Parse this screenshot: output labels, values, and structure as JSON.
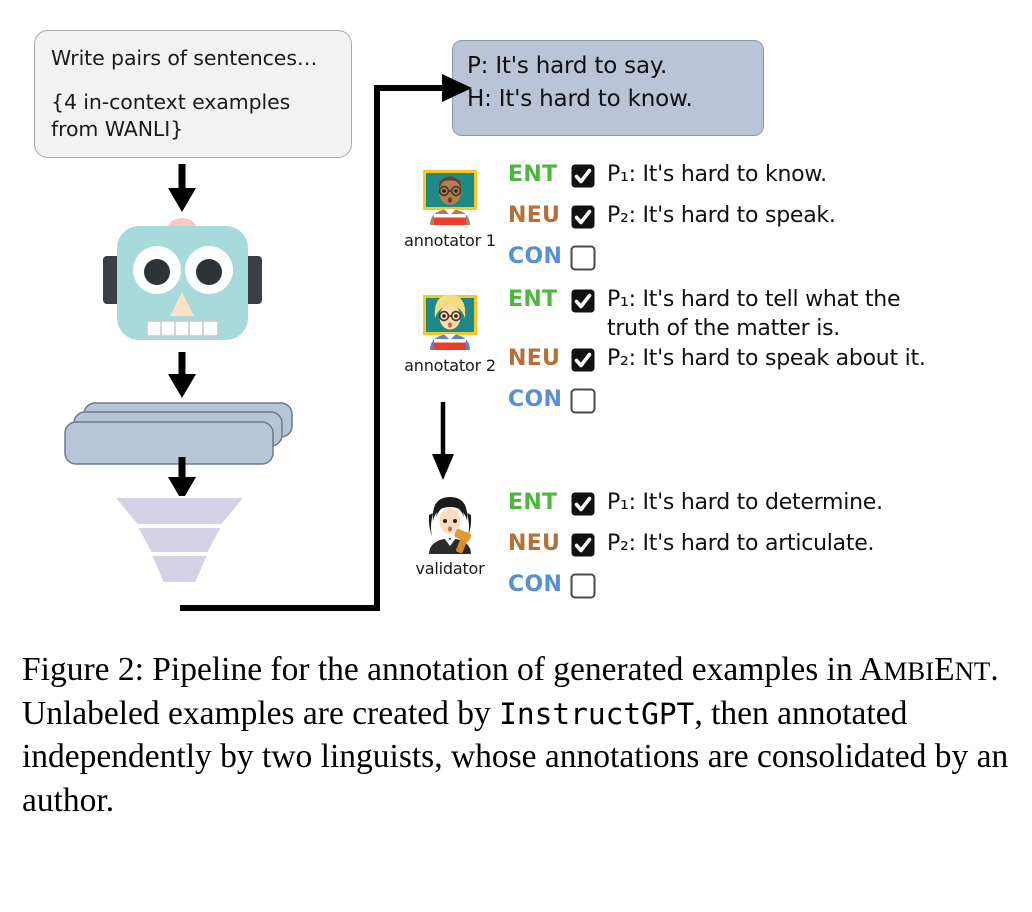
{
  "prompt_box": {
    "line1": "Write pairs of sentences…",
    "line2": "{4 in-context examples",
    "line3": "from WANLI}"
  },
  "example_box": {
    "premise": "P: It's hard to say.",
    "hypothesis": "H: It's hard to know."
  },
  "icons": {
    "robot": "robot-icon",
    "cards": "stacked-examples-icon",
    "funnel": "filter-funnel-icon",
    "arrow_down": "arrow-down-icon",
    "arrow_right": "arrow-right-icon",
    "checked": "checkbox-checked-icon",
    "unchecked": "checkbox-unchecked-icon"
  },
  "colors": {
    "ent": "#4cb63f",
    "neu": "#b5703a",
    "con": "#5b8fd4",
    "bubble_bg": "#b9c4d6",
    "prompt_bg": "#f2f2f2",
    "robot_head": "#a8dadc",
    "cards": "#b8c5d6",
    "funnel": "#d5d2e5"
  },
  "annotations": [
    {
      "avatar": "teacher-brown-hair-emoji",
      "label": "annotator 1",
      "rows": [
        {
          "tag": "ENT",
          "tag_class": "ent",
          "checked": true,
          "text": "P₁: It's hard to know."
        },
        {
          "tag": "NEU",
          "tag_class": "neu",
          "checked": true,
          "text": "P₂: It's hard to speak."
        },
        {
          "tag": "CON",
          "tag_class": "con",
          "checked": false,
          "text": ""
        }
      ]
    },
    {
      "avatar": "teacher-blonde-hair-emoji",
      "label": "annotator 2",
      "rows": [
        {
          "tag": "ENT",
          "tag_class": "ent",
          "checked": true,
          "text": "P₁: It's hard to tell what the\ntruth of the matter is."
        },
        {
          "tag": "NEU",
          "tag_class": "neu",
          "checked": true,
          "text": "P₂: It's hard to speak about it."
        },
        {
          "tag": "CON",
          "tag_class": "con",
          "checked": false,
          "text": ""
        }
      ]
    },
    {
      "avatar": "judge-emoji",
      "label": "validator",
      "rows": [
        {
          "tag": "ENT",
          "tag_class": "ent",
          "checked": true,
          "text": "P₁: It's hard to determine."
        },
        {
          "tag": "NEU",
          "tag_class": "neu",
          "checked": true,
          "text": "P₂: It's hard to articulate."
        },
        {
          "tag": "CON",
          "tag_class": "con",
          "checked": false,
          "text": ""
        }
      ]
    }
  ],
  "caption": {
    "prefix": "Figure 2: Pipeline for the annotation of generated examples in ",
    "dataset_first": "A",
    "dataset_rest_1": "MBI",
    "dataset_e": "E",
    "dataset_rest_2": "NT",
    "middle": ". Unlabeled examples are created by ",
    "model": "InstructGPT",
    "suffix": ", then annotated independently by two linguists, whose annotations are consolidated by an author."
  }
}
